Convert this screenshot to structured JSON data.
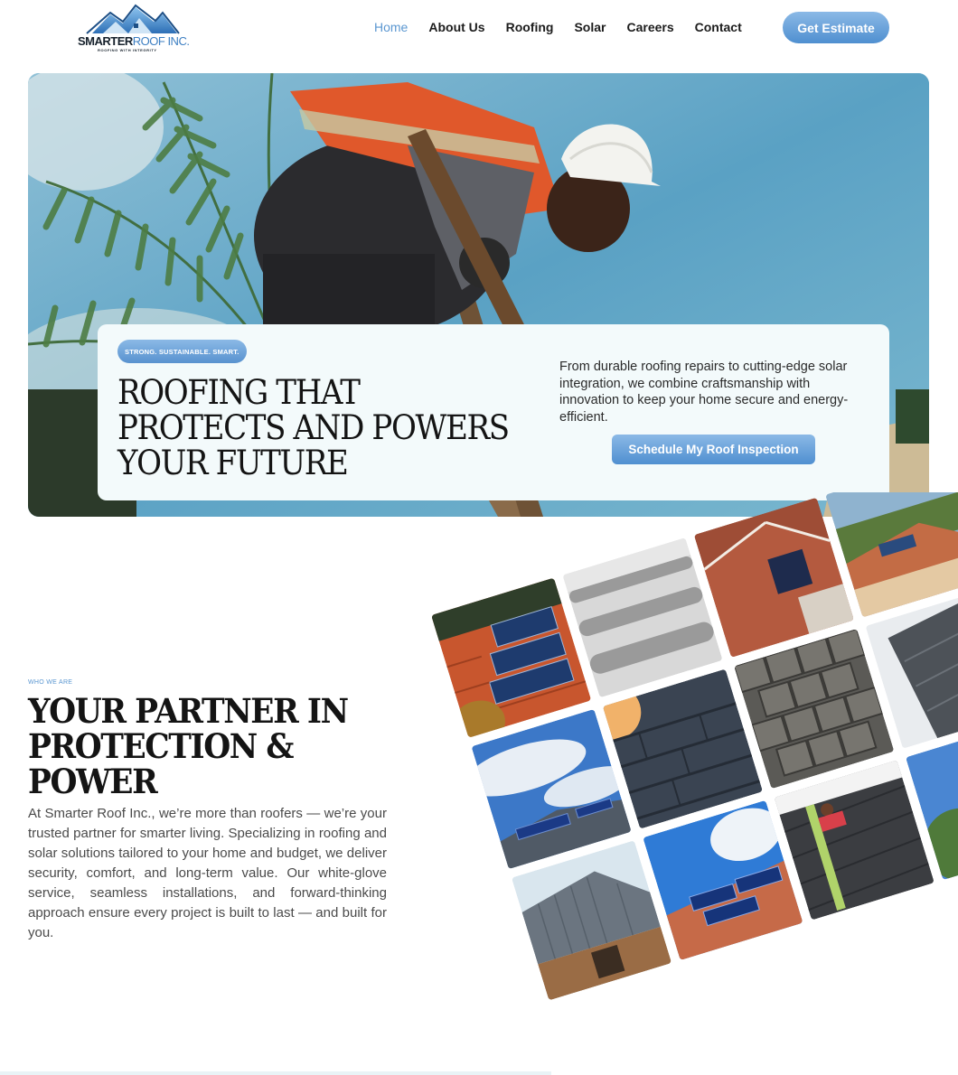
{
  "brand": {
    "name_bold": "SMARTER",
    "name_light": "ROOF INC.",
    "tagline": "ROOFING WITH INTEGRITY"
  },
  "nav": {
    "items": [
      "Home",
      "About Us",
      "Roofing",
      "Solar",
      "Careers",
      "Contact"
    ],
    "active": "Home",
    "cta": "Get Estimate"
  },
  "hero": {
    "badge": "STRONG. SUSTAINABLE. SMART.",
    "title": "ROOFING THAT PROTECTS AND POWERS YOUR FUTURE",
    "description": "From durable roofing repairs to cutting-edge solar integration, we combine craftsmanship with innovation to keep your home secure and energy-efficient.",
    "cta": "Schedule My Roof Inspection"
  },
  "about": {
    "eyebrow": "WHO WE ARE",
    "title": "YOUR PARTNER IN PROTECTION & POWER",
    "body": "At Smarter Roof Inc., we’re more than roofers — we’re your trusted partner for smarter living. Specializing in roofing and solar solutions tailored to your home and budget, we deliver security, comfort, and long-term value. Our white-glove service, seamless installations, and forward-thinking approach ensure every project is built to last — and built for you."
  },
  "colors": {
    "accent": "#5b97d1",
    "button_gradient_top": "#8bb9e6",
    "button_gradient_bottom": "#4f8fd0",
    "card_bg": "#f3fafb"
  },
  "icons": {
    "logo": "house-roof-logo-icon"
  }
}
